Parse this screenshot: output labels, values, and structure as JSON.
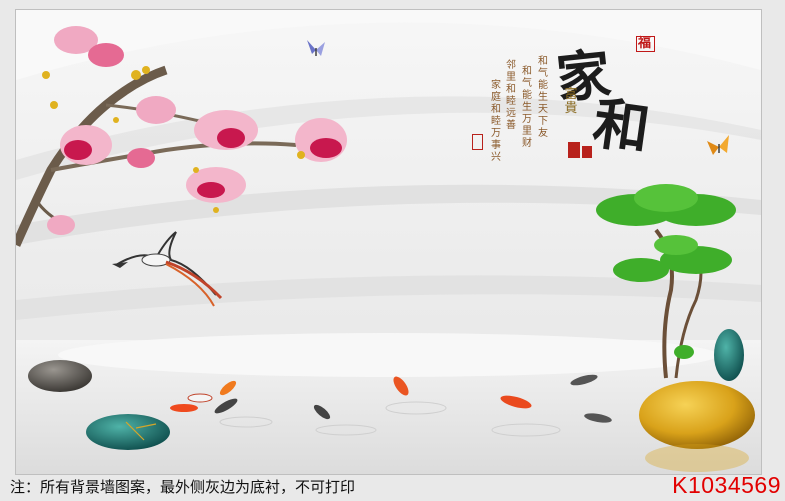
{
  "artwork": {
    "title_char_1": "家",
    "title_char_2": "和",
    "top_seal": "福",
    "subtitle": "富貴",
    "poem_columns": [
      "和气能生天下友",
      "和气能生万里财",
      "邻里和睦远善",
      "家庭和睦万事兴"
    ],
    "elements": [
      "magnolia-branch",
      "butterfly",
      "bird",
      "koi-fish",
      "stones",
      "green-tree",
      "water-reflection"
    ]
  },
  "footer": {
    "note": "注：所有背景墙图案，最外侧灰边为底衬，不可打印",
    "product_code": "K1034569"
  },
  "colors": {
    "code_red": "#e20000",
    "magnolia_pink": "#d8356a",
    "tree_green": "#3fae2a"
  }
}
